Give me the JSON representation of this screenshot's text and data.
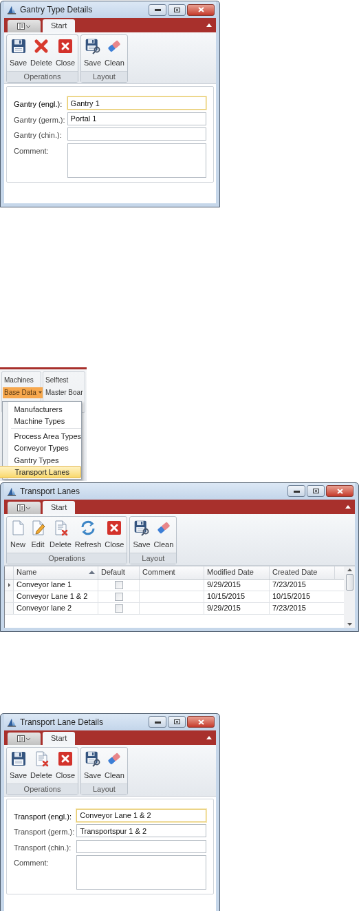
{
  "panels": [
    {
      "kind": "form",
      "title": "Gantry Type Details",
      "tabs": [
        {
          "label": "Start",
          "selected": true
        }
      ],
      "groups": [
        {
          "label": "Operations",
          "buttons": [
            {
              "kind": "save",
              "label": "Save"
            },
            {
              "kind": "delete",
              "label": "Delete"
            },
            {
              "kind": "close",
              "label": "Close"
            }
          ]
        },
        {
          "label": "Layout",
          "buttons": [
            {
              "kind": "layout-save",
              "label": "Save"
            },
            {
              "kind": "clean",
              "label": "Clean"
            }
          ]
        }
      ],
      "fields": [
        {
          "kind": "line",
          "label": "Gantry (engl.):",
          "value": "Gantry 1",
          "focused": true
        },
        {
          "kind": "line",
          "label": "Gantry (germ.):",
          "value": "Portal 1",
          "focused": false
        },
        {
          "kind": "line",
          "label": "Gantry (chin.):",
          "focused": false
        },
        {
          "kind": "multiline",
          "label": "Comment:",
          "focused": false
        }
      ]
    },
    {
      "kind": "menu",
      "ribbon_columns": [
        [
          {
            "label": "Machines",
            "open": false
          },
          {
            "label": "Base Data",
            "open": true
          }
        ],
        [
          {
            "label": "Selftest",
            "open": false
          },
          {
            "label": "Master Boar",
            "open": false
          }
        ]
      ],
      "items": [
        {
          "kind": "item",
          "label": "Manufacturers",
          "selected": false
        },
        {
          "kind": "item",
          "label": "Machine Types",
          "selected": false
        },
        {
          "kind": "separator"
        },
        {
          "kind": "item",
          "label": "Process Area Types",
          "selected": false
        },
        {
          "kind": "item",
          "label": "Conveyor Types",
          "selected": false
        },
        {
          "kind": "item",
          "label": "Gantry Types",
          "selected": false
        },
        {
          "kind": "item",
          "label": "Transport Lanes",
          "selected": true
        }
      ]
    },
    {
      "kind": "grid",
      "title": "Transport Lanes",
      "tabs": [
        {
          "label": "Start",
          "selected": true
        }
      ],
      "groups": [
        {
          "label": "Operations",
          "buttons": [
            {
              "kind": "new",
              "label": "New"
            },
            {
              "kind": "edit",
              "label": "Edit"
            },
            {
              "kind": "delete-document",
              "label": "Delete"
            },
            {
              "kind": "refresh",
              "label": "Refresh"
            },
            {
              "kind": "close",
              "label": "Close"
            }
          ]
        },
        {
          "label": "Layout",
          "buttons": [
            {
              "kind": "layout-save",
              "label": "Save"
            },
            {
              "kind": "clean",
              "label": "Clean"
            }
          ]
        }
      ],
      "columns": [
        {
          "label": "Name",
          "sorted": true
        },
        {
          "label": "Default",
          "sorted": false
        },
        {
          "label": "Comment",
          "sorted": false
        },
        {
          "label": "Modified Date",
          "sorted": false
        },
        {
          "label": "Created Date",
          "sorted": false
        }
      ],
      "rows": [
        {
          "name": "Conveyor lane 1",
          "default": false,
          "modified": "9/29/2015",
          "created": "7/23/2015",
          "current": true
        },
        {
          "name": "Conveyor Lane 1 & 2",
          "default": false,
          "modified": "10/15/2015",
          "created": "10/15/2015",
          "current": false
        },
        {
          "name": "Conveyor lane 2",
          "default": false,
          "modified": "9/29/2015",
          "created": "7/23/2015",
          "current": false
        }
      ]
    },
    {
      "kind": "form",
      "title": "Transport Lane Details",
      "tabs": [
        {
          "label": "Start",
          "selected": true
        }
      ],
      "groups": [
        {
          "label": "Operations",
          "buttons": [
            {
              "kind": "save",
              "label": "Save"
            },
            {
              "kind": "delete-document",
              "label": "Delete"
            },
            {
              "kind": "close",
              "label": "Close"
            }
          ]
        },
        {
          "label": "Layout",
          "buttons": [
            {
              "kind": "layout-save",
              "label": "Save"
            },
            {
              "kind": "clean",
              "label": "Clean"
            }
          ]
        }
      ],
      "fields": [
        {
          "kind": "line",
          "label": "Transport (engl.):",
          "value": "Conveyor Lane 1 & 2",
          "focused": true
        },
        {
          "kind": "line",
          "label": "Transport (germ.):",
          "value": "Transportspur 1 & 2",
          "focused": false
        },
        {
          "kind": "line",
          "label": "Transport (chin.):",
          "focused": false
        },
        {
          "kind": "multiline",
          "label": "Comment:",
          "focused": false
        }
      ]
    }
  ]
}
